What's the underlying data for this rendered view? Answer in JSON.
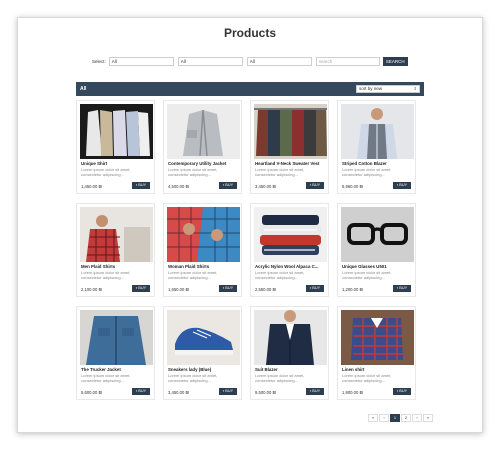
{
  "page": {
    "title": "Products"
  },
  "filters": {
    "label": "Select:",
    "selects": [
      "All",
      "All",
      "All"
    ],
    "search_placeholder": "search",
    "search_button": "SEARCH"
  },
  "category_bar": {
    "label": "All",
    "sort_value": "sort by new",
    "sort_caret": "⇕"
  },
  "products": [
    {
      "name": "Unique Shirt",
      "desc": "Lorem ipsum dolor sit amet, consectetur adipiscing...",
      "price": "1,450.00 ₪",
      "buy": "BUY",
      "image": "shirts-on-hangers"
    },
    {
      "name": "Contemporary Utility Jacket",
      "desc": "Lorem ipsum dolor sit amet, consectetur adipiscing...",
      "price": "4,500.00 ₪",
      "buy": "BUY",
      "image": "jacket-on-hanger"
    },
    {
      "name": "Heartland V-Neck Sweater Vest",
      "desc": "Lorem ipsum dolor sit amet, consectetur adipiscing...",
      "price": "3,450.00 ₪",
      "buy": "BUY",
      "image": "sweaters-on-rack"
    },
    {
      "name": "Striped Cotton Blazer",
      "desc": "Lorem ipsum dolor sit amet, consectetur adipiscing...",
      "price": "6,960.00 ₪",
      "buy": "BUY",
      "image": "man-in-vest"
    },
    {
      "name": "Men Plaid Shirts",
      "desc": "Lorem ipsum dolor sit amet, consectetur adipiscing...",
      "price": "2,100.00 ₪",
      "buy": "BUY",
      "image": "plaid-shirt-man"
    },
    {
      "name": "Woman Plaid Shirts",
      "desc": "Lorem ipsum dolor sit amet, consectetur adipiscing...",
      "price": "1,650.00 ₪",
      "buy": "BUY",
      "image": "plaid-shirt-women"
    },
    {
      "name": "Acrylic Nylon Wool Alpaca C...",
      "desc": "Lorem ipsum dolor sit amet, consectetur adipiscing...",
      "price": "2,550.00 ₪",
      "buy": "BUY",
      "image": "folded-sweaters"
    },
    {
      "name": "Unique Glasses U501",
      "desc": "Lorem ipsum dolor sit amet, consectetur adipiscing...",
      "price": "1,200.00 ₪",
      "buy": "BUY",
      "image": "black-glasses"
    },
    {
      "name": "The Trucker Jacket",
      "desc": "Lorem ipsum dolor sit amet, consectetur adipiscing...",
      "price": "5,600.00 ₪",
      "buy": "BUY",
      "image": "denim-jacket"
    },
    {
      "name": "Sneakers lady (Blue)",
      "desc": "Lorem ipsum dolor sit amet, consectetur adipiscing...",
      "price": "3,450.00 ₪",
      "buy": "BUY",
      "image": "blue-sneaker"
    },
    {
      "name": "Suit Blazer",
      "desc": "Lorem ipsum dolor sit amet, consectetur adipiscing...",
      "price": "9,500.00 ₪",
      "buy": "BUY",
      "image": "navy-blazer"
    },
    {
      "name": "Linen shirt",
      "desc": "Lorem ipsum dolor sit amet, consectetur adipiscing...",
      "price": "1,900.00 ₪",
      "buy": "BUY",
      "image": "checked-shirt"
    }
  ],
  "pagination": {
    "items": [
      "«",
      "‹",
      "1",
      "2",
      "›",
      "»"
    ],
    "active": "1"
  }
}
